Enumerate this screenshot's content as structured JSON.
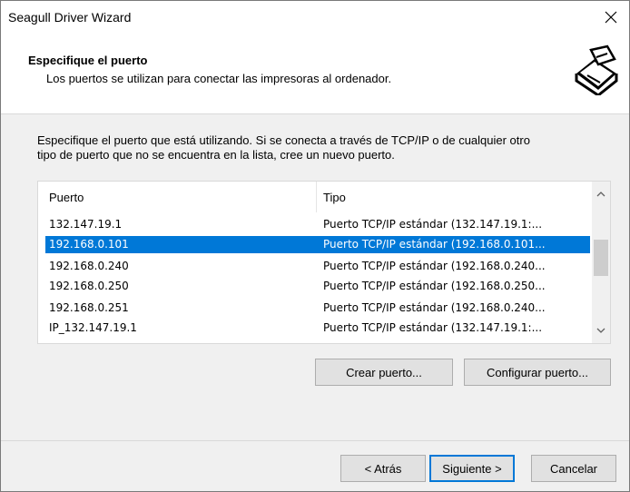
{
  "window": {
    "title": "Seagull Driver Wizard"
  },
  "header": {
    "title": "Especifique el puerto",
    "subtitle": "Los puertos se utilizan para conectar las impresoras al ordenador."
  },
  "description": {
    "line1": "Especifique el puerto que está utilizando. Si se conecta a través de TCP/IP o de cualquier otro",
    "line2": "tipo de puerto que no se encuentra en la lista, cree un nuevo puerto."
  },
  "ports": {
    "columns": {
      "port": "Puerto",
      "type": "Tipo"
    },
    "rows": [
      {
        "port": "132.147.19.1",
        "type": "Puerto TCP/IP estándar (132.147.19.1:..."
      },
      {
        "port": "192.168.0.101",
        "type": "Puerto TCP/IP estándar (192.168.0.101..."
      },
      {
        "port": "192.168.0.240",
        "type": "Puerto TCP/IP estándar (192.168.0.240..."
      },
      {
        "port": "192.168.0.250",
        "type": "Puerto TCP/IP estándar (192.168.0.250..."
      },
      {
        "port": "192.168.0.251",
        "type": "Puerto TCP/IP estándar (192.168.0.240..."
      },
      {
        "port": "IP_132.147.19.1",
        "type": "Puerto TCP/IP estándar (132.147.19.1:..."
      }
    ],
    "selected_port": "192.168.0.101"
  },
  "buttons": {
    "create_port": "Crear puerto...",
    "configure_port": "Configurar puerto...",
    "back": "< Atrás",
    "next": "Siguiente >",
    "cancel": "Cancelar"
  },
  "colors": {
    "selection": "#0078d7"
  }
}
